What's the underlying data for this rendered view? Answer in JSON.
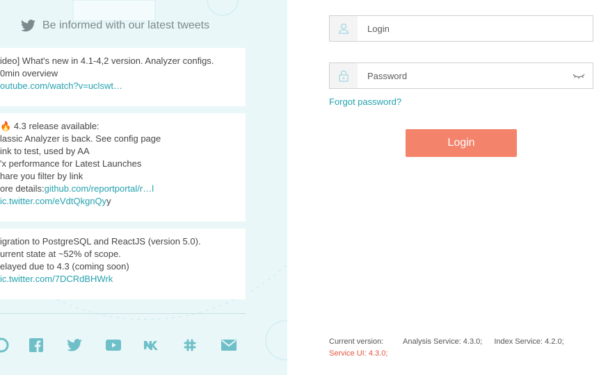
{
  "news": {
    "title": "Be informed with our latest tweets",
    "tweets": [
      {
        "lines": [
          {
            "text": "ideo] What's new in 4.1-4,2 version. Analyzer configs.",
            "link": false
          },
          {
            "text": "0min overview",
            "link": false
          },
          {
            "text": "outube.com/watch?v=uclswt…",
            "link": true
          }
        ]
      },
      {
        "lines": [
          {
            "text": "4.3 release available:",
            "link": false
          },
          {
            "text": "lassic Analyzer is back. See config page",
            "link": false
          },
          {
            "text": "ink to test, used by AA",
            "link": false
          },
          {
            "text": "'x performance for Latest Launches",
            "link": false
          },
          {
            "text": "hare you filter by link",
            "link": false
          },
          {
            "text_prefix": "ore details:",
            "text": "github.com/reportportal/r…l",
            "link": true
          },
          {
            "text": "ic.twitter.com/eVdtQkgnQy",
            "suffix": "y",
            "link": true
          }
        ]
      },
      {
        "lines": [
          {
            "text": "igration to PostgreSQL and ReactJS (version 5.0).",
            "link": false
          },
          {
            "text": "urrent state at ~52% of scope.",
            "link": false
          },
          {
            "text": "elayed due to 4.3 (coming soon)",
            "link": false
          },
          {
            "text": "ic.twitter.com/7DCRdBHWrk",
            "link": true
          }
        ]
      }
    ],
    "social_icons": [
      "github-icon",
      "facebook-icon",
      "twitter-icon",
      "youtube-icon",
      "vk-icon",
      "slack-icon",
      "email-icon"
    ]
  },
  "login_form": {
    "login_placeholder": "Login",
    "password_placeholder": "Password",
    "forgot_label": "Forgot password?",
    "submit_label": "Login"
  },
  "version": {
    "current_label": "Current version:",
    "analysis": "Analysis Service: 4.3.0;",
    "index": "Index Service: 4.2.0;",
    "ui": "Service UI: 4.3.0;"
  },
  "colors": {
    "accent": "#24a1ae",
    "button": "#f3836b",
    "panel_bg": "#e9f7f9",
    "error_text": "#e2553d"
  }
}
